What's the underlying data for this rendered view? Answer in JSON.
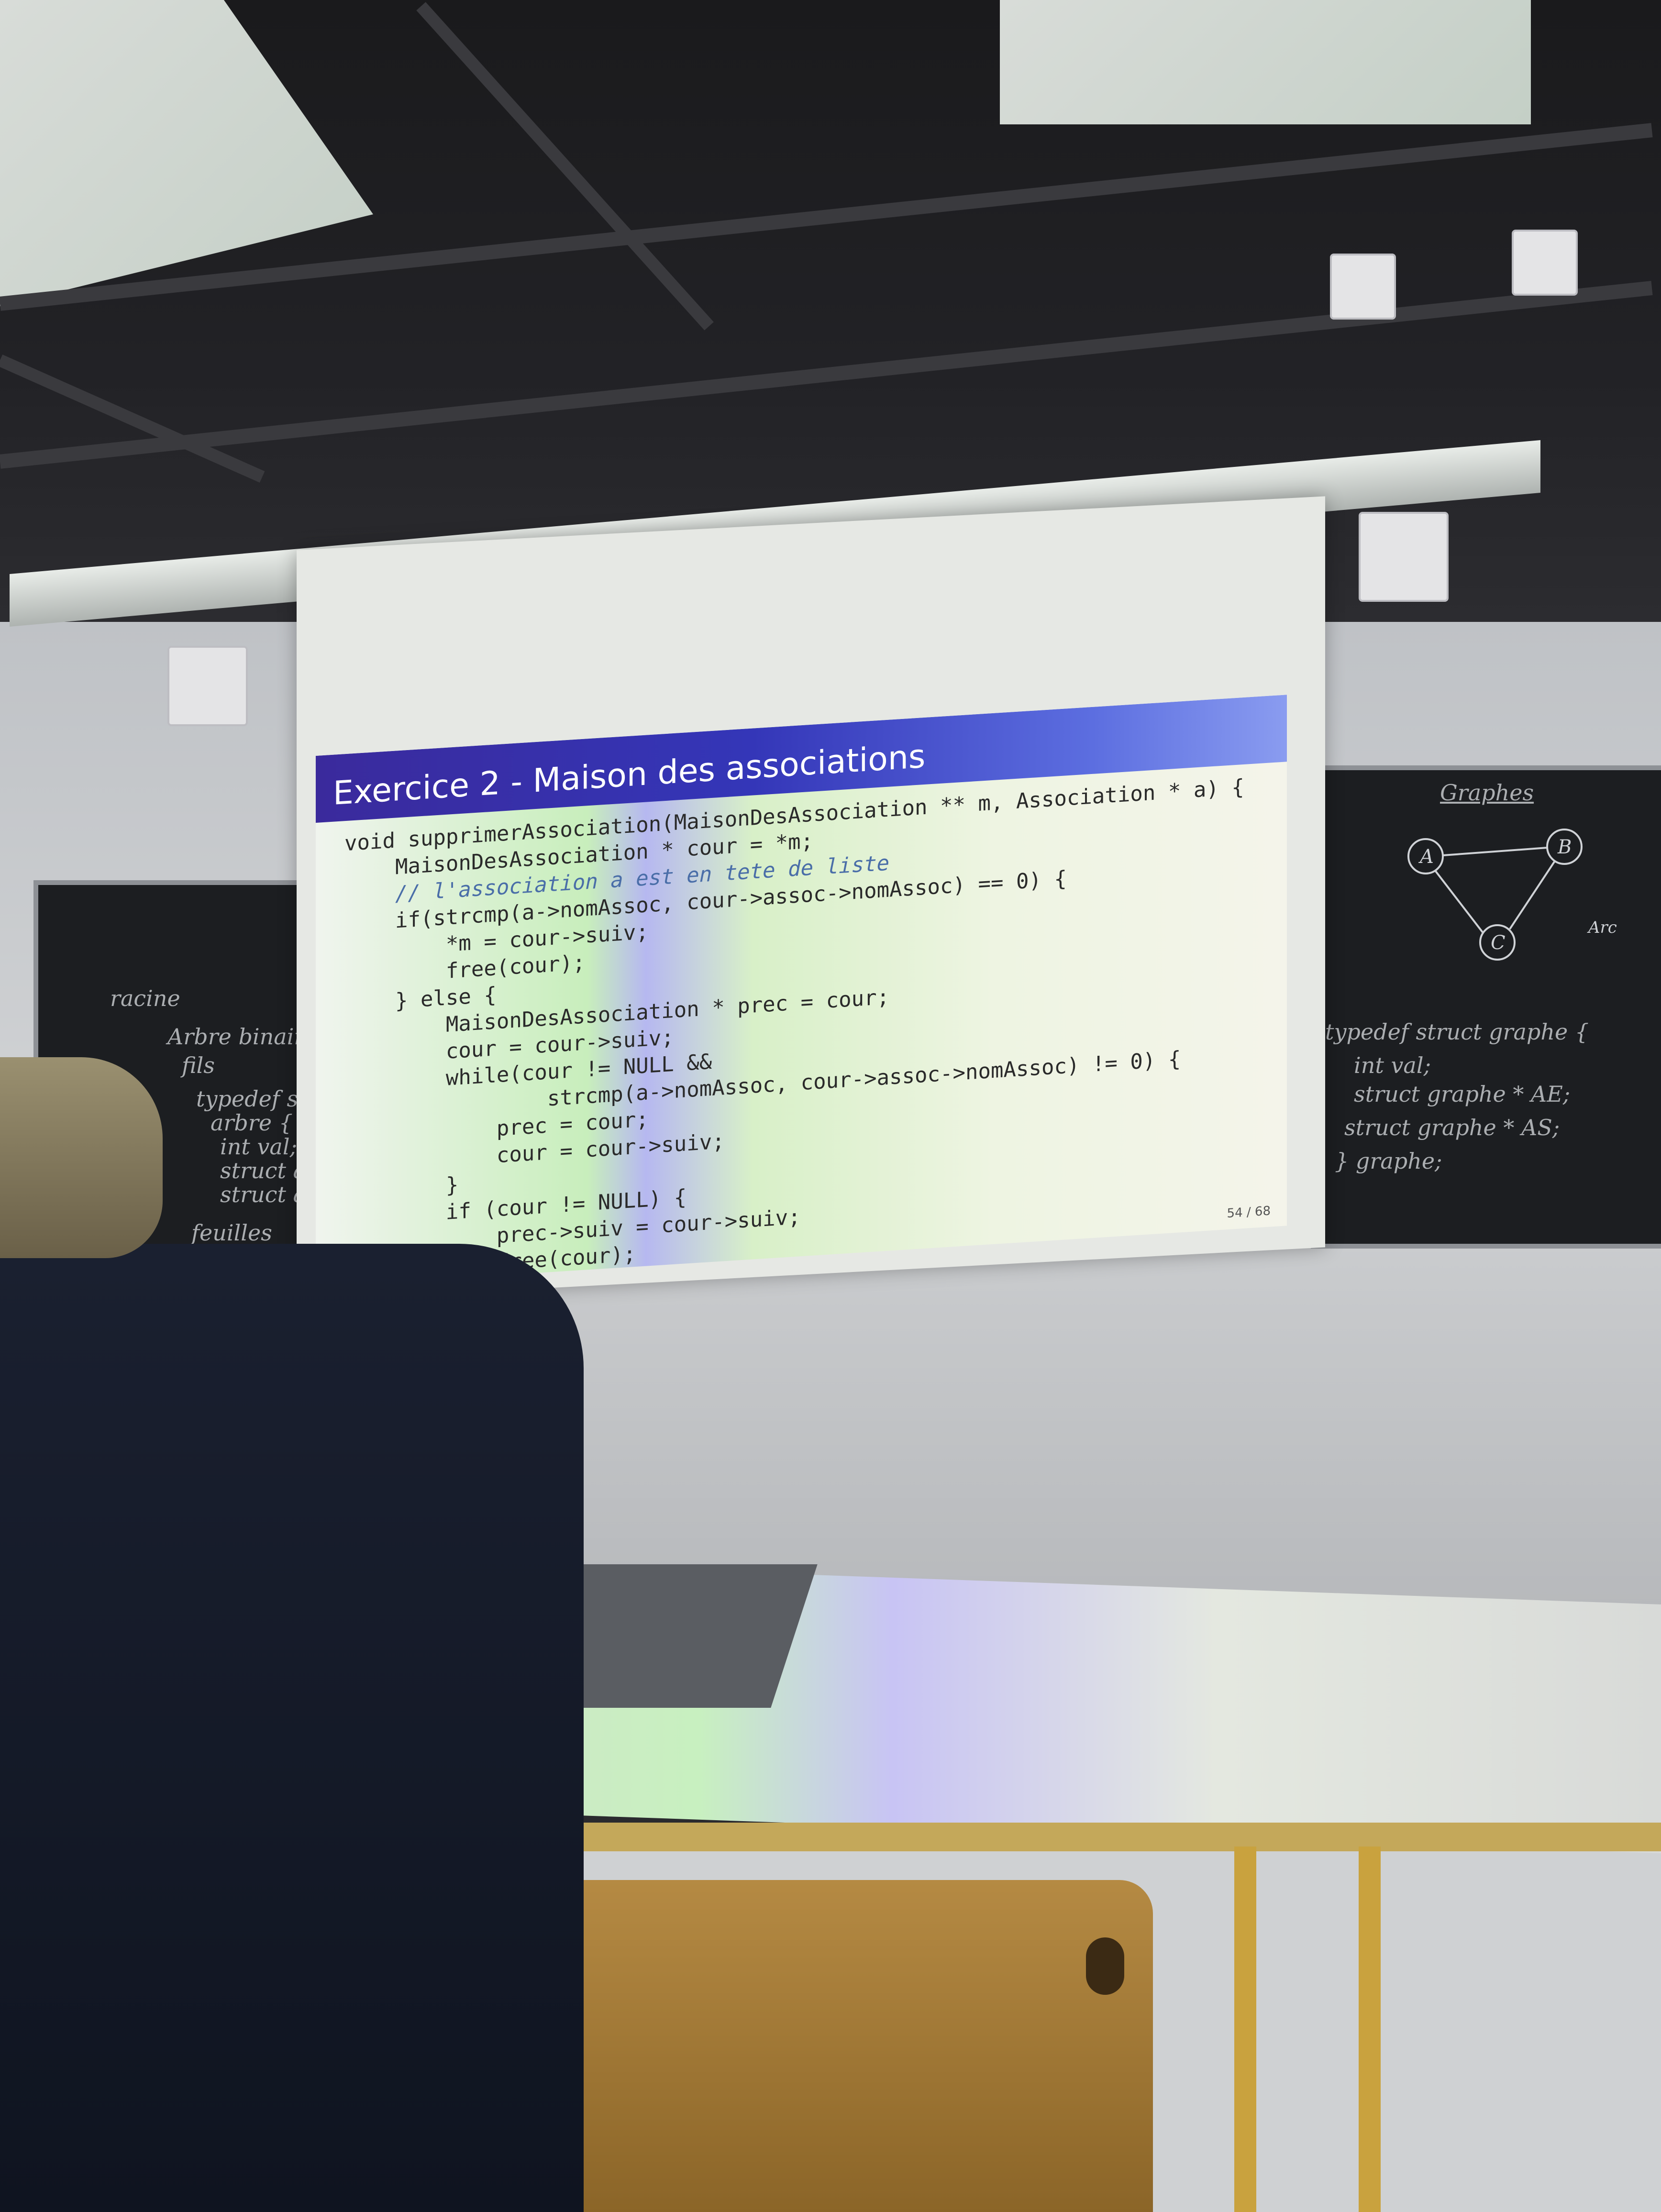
{
  "slide": {
    "title": "Exercice 2 - Maison des associations",
    "code_lines": [
      "void supprimerAssociation(MaisonDesAssociation ** m, Association * a) {",
      "    MaisonDesAssociation * cour = *m;",
      "    // l'association a est en tete de liste",
      "    if(strcmp(a->nomAssoc, cour->assoc->nomAssoc) == 0) {",
      "        *m = cour->suiv;",
      "        free(cour);",
      "    } else {",
      "        MaisonDesAssociation * prec = cour;",
      "        cour = cour->suiv;",
      "        while(cour != NULL &&",
      "                strcmp(a->nomAssoc, cour->assoc->nomAssoc) != 0) {",
      "            prec = cour;",
      "            cour = cour->suiv;",
      "        }",
      "        if (cour != NULL) {",
      "            prec->suiv = cour->suiv;",
      "            free(cour);",
      "        }",
      "    }",
      "}"
    ],
    "page_number": "54 / 68"
  },
  "left_board": {
    "lines": [
      "racine",
      "Arbre binaire",
      "fils",
      "typedef struct",
      "arbre {",
      "int val;",
      "struct arbre",
      "struct arbre",
      "feuilles"
    ]
  },
  "right_board": {
    "heading": "Graphes",
    "nodes": [
      "A",
      "B",
      "C"
    ],
    "edge_label": "Arc",
    "lines": [
      "typedef struct graphe {",
      "int val;",
      "struct graphe * AE;",
      "struct graphe * AS;",
      "} graphe;"
    ]
  }
}
